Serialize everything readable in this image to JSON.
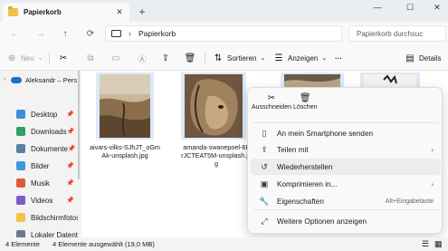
{
  "tab": {
    "title": "Papierkorb"
  },
  "address": {
    "crumb": "Papierkorb",
    "search_placeholder": "Papierkorb durchsuc"
  },
  "toolbar": {
    "new_label": "Neu",
    "sort_label": "Sortieren",
    "view_label": "Anzeigen",
    "more_label": "···",
    "details_label": "Details"
  },
  "sidebar": {
    "home": "Aleksandr – Pers",
    "items": [
      {
        "label": "Desktop",
        "icon": "desktop-icon",
        "color": "#3d8fd9"
      },
      {
        "label": "Downloads",
        "icon": "downloads-icon",
        "color": "#2f9e6a"
      },
      {
        "label": "Dokumente",
        "icon": "documents-icon",
        "color": "#5b7fa8"
      },
      {
        "label": "Bilder",
        "icon": "pictures-icon",
        "color": "#3b9bd9"
      },
      {
        "label": "Musik",
        "icon": "music-icon",
        "color": "#e05a3a"
      },
      {
        "label": "Videos",
        "icon": "videos-icon",
        "color": "#7b5cc7"
      },
      {
        "label": "Bildschirmfotos",
        "icon": "folder-icon",
        "color": "#f0c24a"
      },
      {
        "label": "Lokaler Datentra",
        "icon": "drive-icon",
        "color": "#6b7b8c"
      }
    ]
  },
  "files": [
    {
      "line1": "aivars-vilks-SJhJT_oGm",
      "line2": "Ak-unsplash.jpg",
      "line3": ""
    },
    {
      "line1": "amanda-swanepoel-6F",
      "line2": "rJCTEAT5M-unsplash.jp",
      "line3": "g"
    }
  ],
  "context_menu": {
    "cut": "Ausschneiden",
    "delete": "Löschen",
    "items": [
      {
        "label": "An mein Smartphone senden",
        "icon": "phone-icon",
        "extra": ""
      },
      {
        "label": "Teilen mit",
        "icon": "share-icon",
        "extra": "›"
      },
      {
        "label": "Wiederherstellen",
        "icon": "restore-icon",
        "extra": ""
      },
      {
        "label": "Komprimieren in...",
        "icon": "archive-icon",
        "extra": "›"
      },
      {
        "label": "Eigenschaften",
        "icon": "properties-icon",
        "extra": "Alt+Eingabetaste"
      },
      {
        "label": "Weitere Optionen anzeigen",
        "icon": "more-options-icon",
        "extra": ""
      }
    ]
  },
  "status": {
    "count": "4 Elemente",
    "selected": "4 Elemente ausgewählt (19,0 MB)"
  }
}
